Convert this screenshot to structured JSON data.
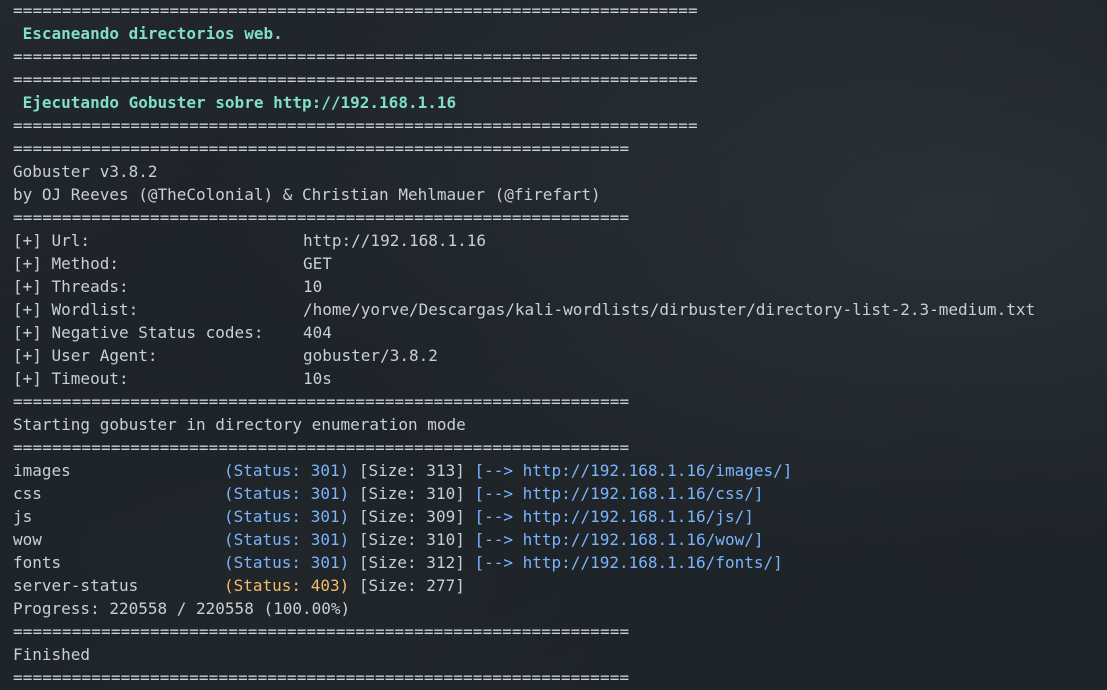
{
  "separators": {
    "long": "======================================================================",
    "short": "==============================================================="
  },
  "header1": " Escaneando directorios web.",
  "header2": " Ejecutando Gobuster sobre http://192.168.1.16",
  "banner": {
    "version": "Gobuster v3.8.2",
    "authors": "by OJ Reeves (@TheColonial) & Christian Mehlmauer (@firefart)"
  },
  "config": [
    {
      "key": "[+] Url:",
      "value": "http://192.168.1.16"
    },
    {
      "key": "[+] Method:",
      "value": "GET"
    },
    {
      "key": "[+] Threads:",
      "value": "10"
    },
    {
      "key": "[+] Wordlist:",
      "value": "/home/yorve/Descargas/kali-wordlists/dirbuster/directory-list-2.3-medium.txt"
    },
    {
      "key": "[+] Negative Status codes:",
      "value": "404"
    },
    {
      "key": "[+] User Agent:",
      "value": "gobuster/3.8.2"
    },
    {
      "key": "[+] Timeout:",
      "value": "10s"
    }
  ],
  "mode_line": "Starting gobuster in directory enumeration mode",
  "results": [
    {
      "path": "images",
      "status": "(Status: 301)",
      "size": "[Size: 313]",
      "redirect": "[--> http://192.168.1.16/images/]"
    },
    {
      "path": "css",
      "status": "(Status: 301)",
      "size": "[Size: 310]",
      "redirect": "[--> http://192.168.1.16/css/]"
    },
    {
      "path": "js",
      "status": "(Status: 301)",
      "size": "[Size: 309]",
      "redirect": "[--> http://192.168.1.16/js/]"
    },
    {
      "path": "wow",
      "status": "(Status: 301)",
      "size": "[Size: 310]",
      "redirect": "[--> http://192.168.1.16/wow/]"
    },
    {
      "path": "fonts",
      "status": "(Status: 301)",
      "size": "[Size: 312]",
      "redirect": "[--> http://192.168.1.16/fonts/]"
    },
    {
      "path": "server-status",
      "status": "(Status: 403)",
      "size": "[Size: 277]",
      "redirect": ""
    }
  ],
  "progress": "Progress: 220558 / 220558 (100.00%)",
  "finished": "Finished",
  "colors": {
    "header": "#7fe0c6",
    "status_ok": "#7ab4ff",
    "status_forbidden": "#f3bd6a",
    "text": "#c9cfd6"
  }
}
